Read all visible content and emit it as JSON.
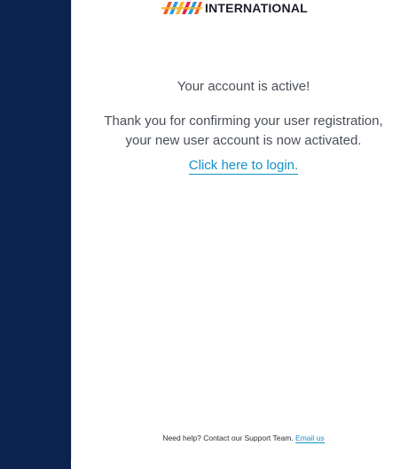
{
  "brand": {
    "name": "INTERNATIONAL",
    "colors": [
      "#f05a28",
      "#2c9cd8",
      "#f7b52c",
      "#e2224b"
    ]
  },
  "content": {
    "status": "Your account is active!",
    "message": "Thank you for confirming your user registration, your new user account is now activated.",
    "login_link": "Click here to login."
  },
  "footer": {
    "help_text": "Need help? Contact our Support Team.",
    "email_link": "Email us"
  },
  "colors": {
    "sidebar": "#0c2350",
    "link": "#1591c8",
    "text": "#4a4f58"
  }
}
